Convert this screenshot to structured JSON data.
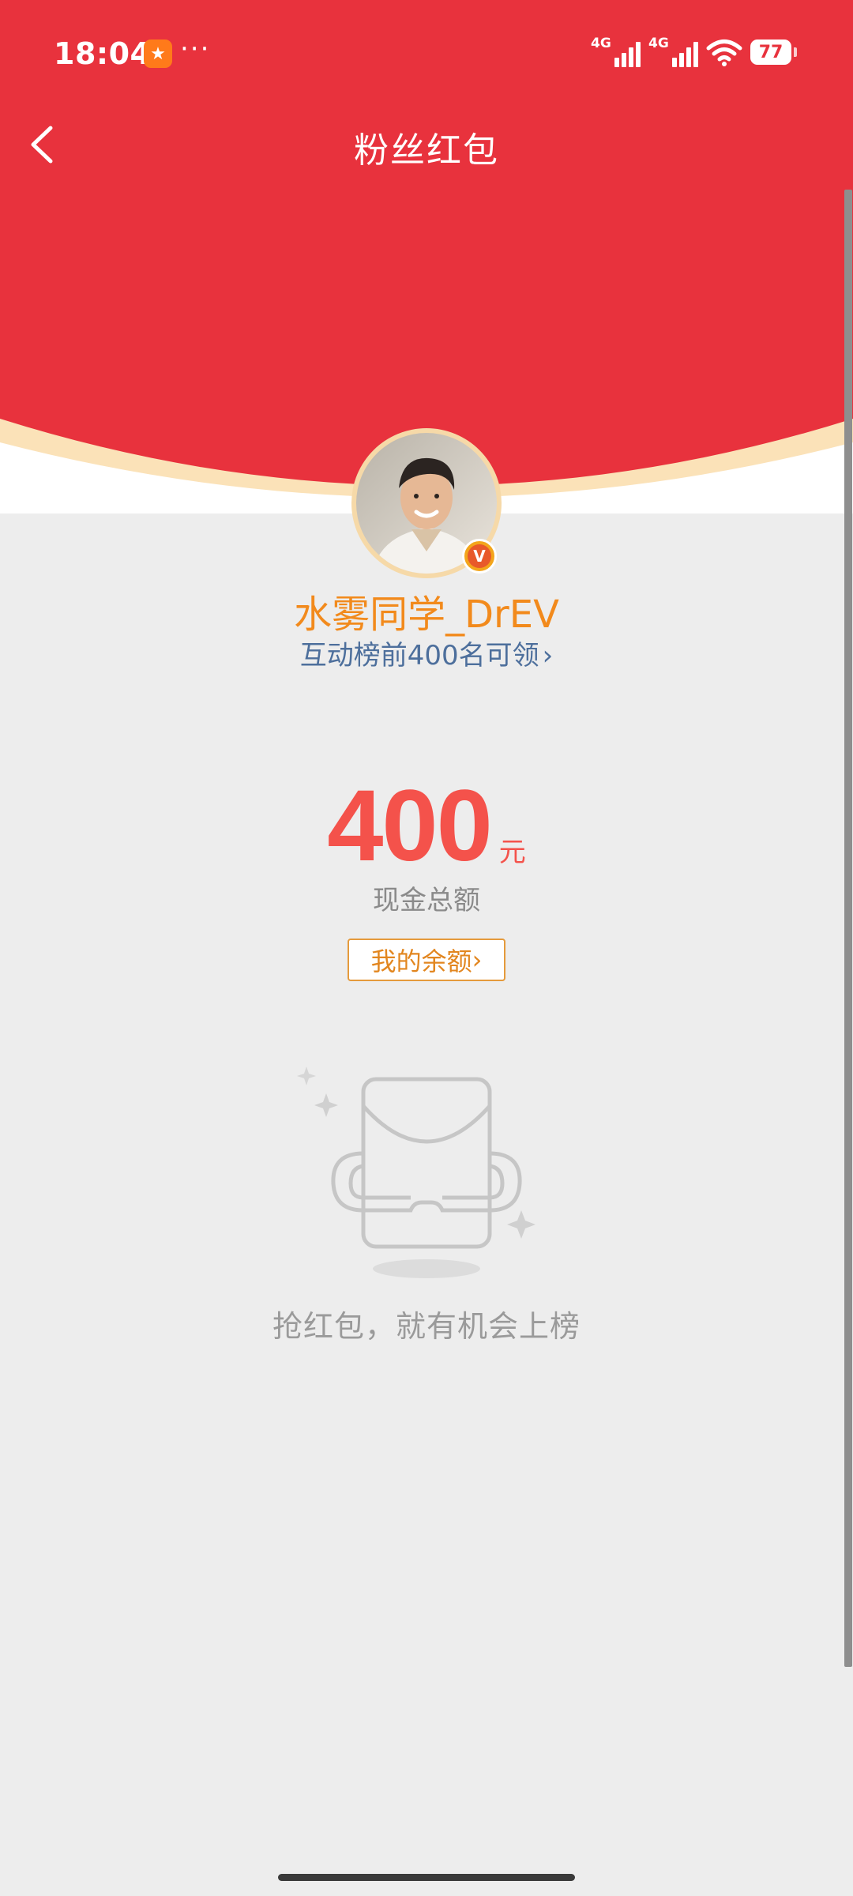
{
  "status_bar": {
    "time": "18:04",
    "dots": "···",
    "signal_1_label": "4G",
    "signal_2_label": "4G",
    "battery": "77"
  },
  "nav": {
    "title": "粉丝红包"
  },
  "profile": {
    "username": "水雾同学_DrEV",
    "rank_link": "互动榜前400名可领",
    "rank_chevron": "›",
    "badge": "V"
  },
  "amount": {
    "value": "400",
    "unit": "元",
    "caption": "现金总额",
    "balance_button": "我的余额",
    "balance_chevron": "›"
  },
  "empty_state": {
    "message": "抢红包，就有机会上榜"
  },
  "colors": {
    "header_red": "#e8323d",
    "accent_orange": "#f28a1c",
    "amount_red": "#f4524b",
    "link_blue": "#4d6f9c",
    "page_gray": "#ededed"
  }
}
